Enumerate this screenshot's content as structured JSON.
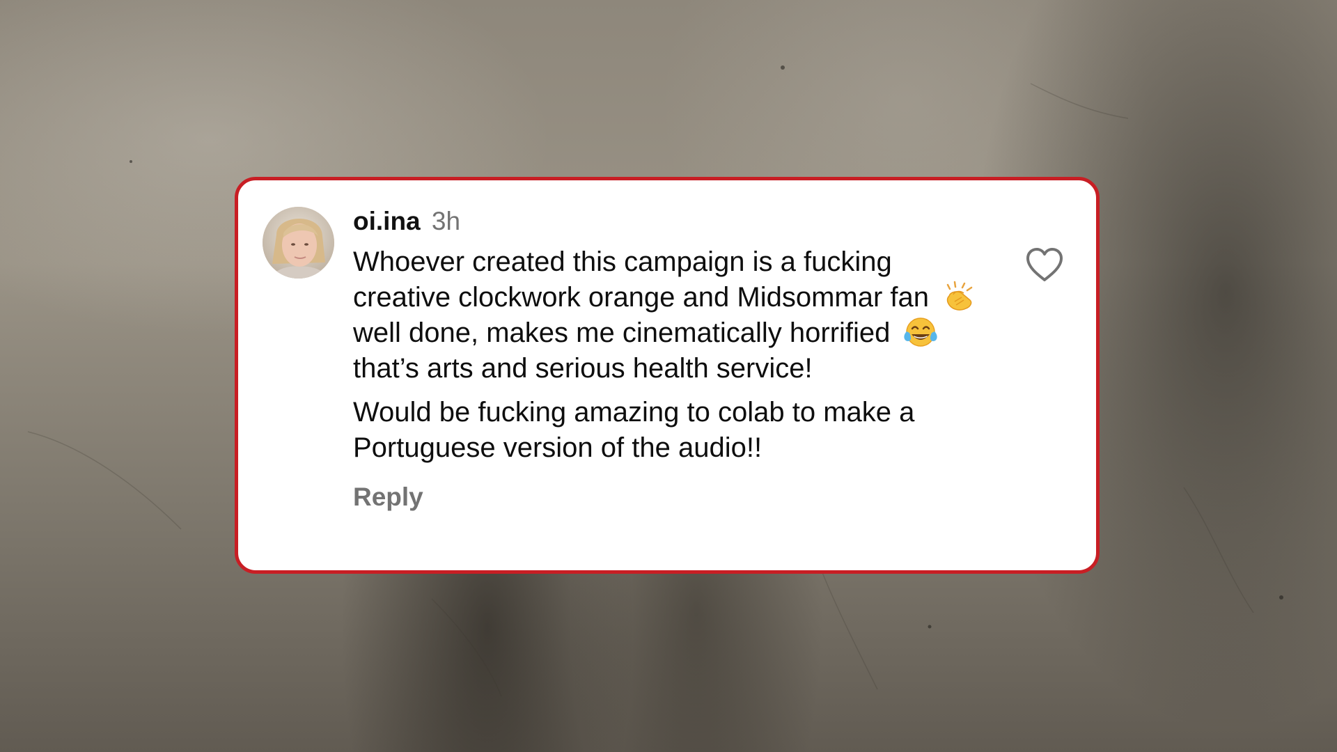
{
  "comment": {
    "username": "oi.ina",
    "time": "3h",
    "para1": {
      "part1": "Whoever created this campaign is a fucking creative clockwork orange and Midsommar fan",
      "emoji1": "clapping-hands-emoji",
      "part2": "well done, makes me cinematically horrified",
      "emoji2": "tears-of-joy-emoji",
      "part3": "that’s arts and serious health service!"
    },
    "para2": "Would be fucking amazing to colab to make a Portuguese version of the audio!!",
    "reply_label": "Reply",
    "like_icon": "heart-outline-icon",
    "avatar": "profile-photo"
  },
  "colors": {
    "card_border": "#c81e24",
    "card_bg": "#ffffff",
    "secondary_text": "#737373"
  }
}
